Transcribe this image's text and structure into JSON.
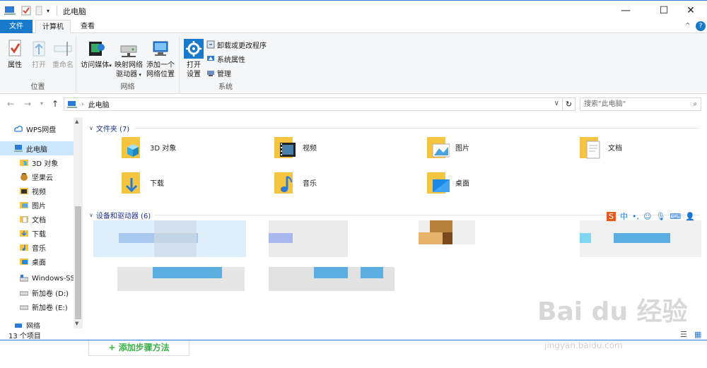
{
  "window": {
    "title": "此电脑"
  },
  "tabs": {
    "file": "文件",
    "computer": "计算机",
    "view": "查看"
  },
  "ribbon": {
    "location": {
      "label": "位置",
      "properties": "属性",
      "open": "打开",
      "rename": "重命名"
    },
    "network": {
      "label": "网络",
      "access_media": "访问媒体",
      "map_drive_1": "映射网络",
      "map_drive_2": "驱动器",
      "add_location_1": "添加一个",
      "add_location_2": "网络位置"
    },
    "system": {
      "label": "系统",
      "open_settings_1": "打开",
      "open_settings_2": "设置",
      "uninstall": "卸载或更改程序",
      "sys_props": "系统属性",
      "manage": "管理"
    }
  },
  "address": {
    "path": "此电脑",
    "search_placeholder": "搜索\"此电脑\""
  },
  "nav": {
    "items": [
      {
        "label": "WPS网盘",
        "icon": "cloud-icon"
      },
      {
        "label": "此电脑",
        "icon": "computer-icon",
        "selected": true
      },
      {
        "label": "3D 对象",
        "icon": "3d-objects-icon"
      },
      {
        "label": "坚果云",
        "icon": "nut-icon"
      },
      {
        "label": "视频",
        "icon": "video-icon"
      },
      {
        "label": "图片",
        "icon": "picture-icon"
      },
      {
        "label": "文档",
        "icon": "document-icon"
      },
      {
        "label": "下载",
        "icon": "download-icon"
      },
      {
        "label": "音乐",
        "icon": "music-icon"
      },
      {
        "label": "桌面",
        "icon": "desktop-icon"
      },
      {
        "label": "Windows-SS",
        "icon": "drive-icon"
      },
      {
        "label": "新加卷 (D:)",
        "icon": "drive-icon"
      },
      {
        "label": "新加卷 (E:)",
        "icon": "drive-icon"
      },
      {
        "label": "网络",
        "icon": "network-icon"
      }
    ]
  },
  "folders_section": {
    "header": "文件夹 (7)",
    "items": [
      {
        "label": "3D 对象",
        "icon": "3d-objects-folder-icon"
      },
      {
        "label": "视频",
        "icon": "video-folder-icon"
      },
      {
        "label": "图片",
        "icon": "picture-folder-icon"
      },
      {
        "label": "文档",
        "icon": "document-folder-icon"
      },
      {
        "label": "下载",
        "icon": "download-folder-icon"
      },
      {
        "label": "音乐",
        "icon": "music-folder-icon"
      },
      {
        "label": "桌面",
        "icon": "desktop-folder-icon"
      }
    ]
  },
  "devices_section": {
    "header": "设备和驱动器 (6)"
  },
  "status": {
    "count": "13 个项目"
  },
  "footer": {
    "add_step": "+ 添加步骤方法"
  },
  "watermark": {
    "brand": "Bai du 经验",
    "url": "jingyan.baidu.com"
  },
  "colors": {
    "accent": "#1979ca",
    "selected": "#cce8ff",
    "folder": "#f5c542"
  }
}
